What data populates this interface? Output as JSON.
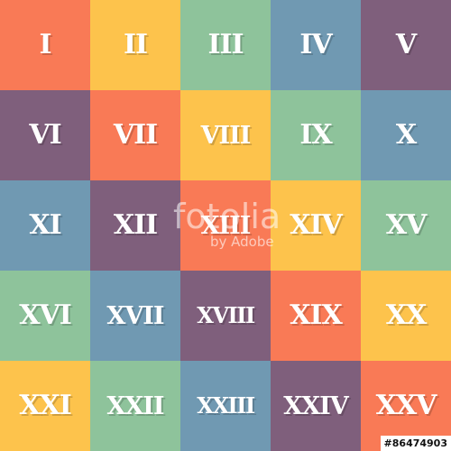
{
  "colors": {
    "orange": "#F97A56",
    "yellow": "#FDC34C",
    "green": "#8EC39B",
    "blue": "#7099B2",
    "purple": "#7F5F7C",
    "numeral_text": "#FFFFFF"
  },
  "tiles": [
    {
      "numeral": "I",
      "color": "#F97A56"
    },
    {
      "numeral": "II",
      "color": "#FDC34C"
    },
    {
      "numeral": "III",
      "color": "#8EC39B"
    },
    {
      "numeral": "IV",
      "color": "#7099B2"
    },
    {
      "numeral": "V",
      "color": "#7F5F7C"
    },
    {
      "numeral": "VI",
      "color": "#7F5F7C"
    },
    {
      "numeral": "VII",
      "color": "#F97A56"
    },
    {
      "numeral": "VIII",
      "color": "#FDC34C"
    },
    {
      "numeral": "IX",
      "color": "#8EC39B"
    },
    {
      "numeral": "X",
      "color": "#7099B2"
    },
    {
      "numeral": "XI",
      "color": "#7099B2"
    },
    {
      "numeral": "XII",
      "color": "#7F5F7C"
    },
    {
      "numeral": "XIII",
      "color": "#F97A56"
    },
    {
      "numeral": "XIV",
      "color": "#FDC34C"
    },
    {
      "numeral": "XV",
      "color": "#8EC39B"
    },
    {
      "numeral": "XVI",
      "color": "#8EC39B"
    },
    {
      "numeral": "XVII",
      "color": "#7099B2"
    },
    {
      "numeral": "XVIII",
      "color": "#7F5F7C"
    },
    {
      "numeral": "XIX",
      "color": "#F97A56"
    },
    {
      "numeral": "XX",
      "color": "#FDC34C"
    },
    {
      "numeral": "XXI",
      "color": "#FDC34C"
    },
    {
      "numeral": "XXII",
      "color": "#8EC39B"
    },
    {
      "numeral": "XXIII",
      "color": "#7099B2"
    },
    {
      "numeral": "XXIV",
      "color": "#7F5F7C"
    },
    {
      "numeral": "XXV",
      "color": "#F97A56"
    }
  ],
  "watermark": {
    "logo": "fotolia",
    "byline": "by Adobe"
  },
  "stock_id": "#86474903"
}
